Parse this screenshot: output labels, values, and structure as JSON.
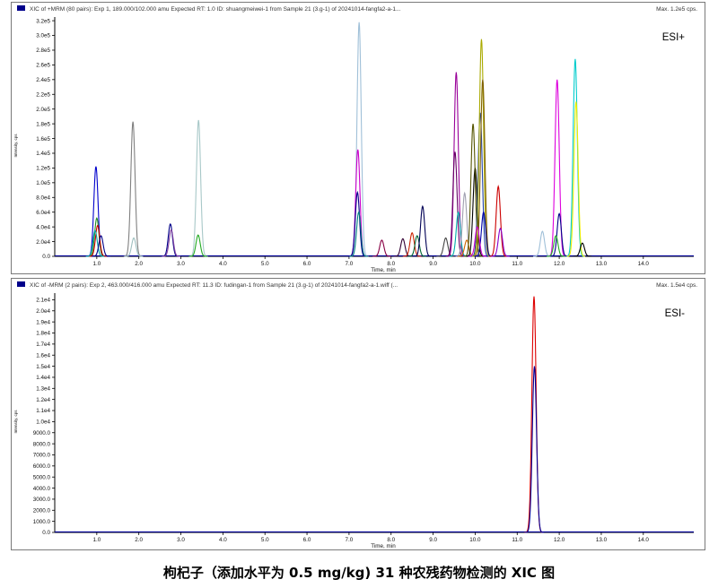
{
  "chart_data": [
    {
      "type": "line",
      "header": "XIC of +MRM (80 pairs): Exp 1, 189.000/102.000 amu Expected RT: 1.0 ID: shuangmeiwei-1 from Sample 21 (3.g-1) of 20241014-fangfa2-a-1...",
      "max_label": "Max. 1.2e5 cps.",
      "ylabel": "Intensity, cps",
      "xlabel": "Time, min",
      "annotation": "ESI+",
      "xlim": [
        0,
        15.2
      ],
      "ylim": [
        0,
        325000
      ],
      "xticks": [
        "1.0",
        "2.0",
        "3.0",
        "4.0",
        "5.0",
        "6.0",
        "7.0",
        "8.0",
        "9.0",
        "10.0",
        "11.0",
        "12.0",
        "13.0",
        "14.0"
      ],
      "yticks": [
        "0.0",
        "2.0e4",
        "4.0e4",
        "6.0e4",
        "8.0e4",
        "1.0e5",
        "1.2e5",
        "1.4e5",
        "1.6e5",
        "1.8e5",
        "2.0e5",
        "2.2e5",
        "2.4e5",
        "2.6e5",
        "2.8e5",
        "3.0e5",
        "3.2e5"
      ],
      "peaks": [
        {
          "rt": 0.98,
          "height": 122000,
          "color": "#0000cc"
        },
        {
          "rt": 1.0,
          "height": 52000,
          "color": "#228b22"
        },
        {
          "rt": 1.02,
          "height": 42000,
          "color": "#cc0000"
        },
        {
          "rt": 0.96,
          "height": 35000,
          "color": "#00a0a0"
        },
        {
          "rt": 1.1,
          "height": 28000,
          "color": "#000088"
        },
        {
          "rt": 1.86,
          "height": 183000,
          "color": "#808080"
        },
        {
          "rt": 1.88,
          "height": 25000,
          "color": "#9fc0c0"
        },
        {
          "rt": 2.75,
          "height": 44000,
          "color": "#000088"
        },
        {
          "rt": 2.77,
          "height": 36000,
          "color": "#8040a0"
        },
        {
          "rt": 3.42,
          "height": 185000,
          "color": "#a8c8c8"
        },
        {
          "rt": 3.41,
          "height": 29000,
          "color": "#22aa22"
        },
        {
          "rt": 7.24,
          "height": 318000,
          "color": "#a0c0d8"
        },
        {
          "rt": 7.21,
          "height": 145000,
          "color": "#cc00cc"
        },
        {
          "rt": 7.2,
          "height": 87000,
          "color": "#000088"
        },
        {
          "rt": 7.23,
          "height": 60000,
          "color": "#008080"
        },
        {
          "rt": 7.78,
          "height": 22000,
          "color": "#880044"
        },
        {
          "rt": 8.28,
          "height": 24000,
          "color": "#330033"
        },
        {
          "rt": 8.5,
          "height": 32000,
          "color": "#cc2200"
        },
        {
          "rt": 8.62,
          "height": 28000,
          "color": "#006633"
        },
        {
          "rt": 8.75,
          "height": 68000,
          "color": "#000055"
        },
        {
          "rt": 9.3,
          "height": 25000,
          "color": "#444444"
        },
        {
          "rt": 9.55,
          "height": 250000,
          "color": "#990099"
        },
        {
          "rt": 9.52,
          "height": 142000,
          "color": "#660066"
        },
        {
          "rt": 9.6,
          "height": 60000,
          "color": "#00aaaa"
        },
        {
          "rt": 9.75,
          "height": 86000,
          "color": "#a0a0b0"
        },
        {
          "rt": 9.8,
          "height": 22000,
          "color": "#cc6600"
        },
        {
          "rt": 10.0,
          "height": 120000,
          "color": "#000000"
        },
        {
          "rt": 9.95,
          "height": 180000,
          "color": "#555500"
        },
        {
          "rt": 10.12,
          "height": 195000,
          "color": "#2244aa"
        },
        {
          "rt": 10.15,
          "height": 295000,
          "color": "#aaaa00"
        },
        {
          "rt": 10.18,
          "height": 240000,
          "color": "#806000"
        },
        {
          "rt": 10.2,
          "height": 60000,
          "color": "#0000aa"
        },
        {
          "rt": 10.05,
          "height": 40000,
          "color": "#cc00cc"
        },
        {
          "rt": 10.55,
          "height": 95000,
          "color": "#cc0000"
        },
        {
          "rt": 10.6,
          "height": 38000,
          "color": "#8800cc"
        },
        {
          "rt": 11.6,
          "height": 34000,
          "color": "#a0c0d8"
        },
        {
          "rt": 11.95,
          "height": 240000,
          "color": "#dd00dd"
        },
        {
          "rt": 12.0,
          "height": 58000,
          "color": "#000088"
        },
        {
          "rt": 11.92,
          "height": 28000,
          "color": "#22aa22"
        },
        {
          "rt": 12.38,
          "height": 268000,
          "color": "#00cccc"
        },
        {
          "rt": 12.4,
          "height": 210000,
          "color": "#eeee00"
        },
        {
          "rt": 12.55,
          "height": 18000,
          "color": "#000000"
        }
      ]
    },
    {
      "type": "line",
      "header": "XIC of -MRM (2 pairs): Exp 2, 463.000/416.000 amu Expected RT: 11.3 ID: fudingan-1 from Sample 21 (3.g-1) of 20241014-fangfa2-a-1.wiff (...",
      "max_label": "Max. 1.5e4 cps.",
      "ylabel": "Intensity, cps",
      "xlabel": "Time, min",
      "annotation": "ESI-",
      "xlim": [
        0,
        15.2
      ],
      "ylim": [
        0,
        21600
      ],
      "xticks": [
        "1.0",
        "2.0",
        "3.0",
        "4.0",
        "5.0",
        "6.0",
        "7.0",
        "8.0",
        "9.0",
        "10.0",
        "11.0",
        "12.0",
        "13.0",
        "14.0"
      ],
      "yticks": [
        "0.0",
        "1000.0",
        "2000.0",
        "3000.0",
        "4000.0",
        "5000.0",
        "6000.0",
        "7000.0",
        "8000.0",
        "9000.0",
        "1.0e4",
        "1.1e4",
        "1.2e4",
        "1.3e4",
        "1.4e4",
        "1.5e4",
        "1.6e4",
        "1.7e4",
        "1.8e4",
        "1.9e4",
        "2.0e4",
        "2.1e4"
      ],
      "peaks": [
        {
          "rt": 11.4,
          "height": 21300,
          "color": "#dd0000"
        },
        {
          "rt": 11.41,
          "height": 15000,
          "color": "#000099"
        }
      ]
    }
  ],
  "caption": "枸杞子（添加水平为 0.5 mg/kg) 31 种农残药物检测的 XIC 图"
}
